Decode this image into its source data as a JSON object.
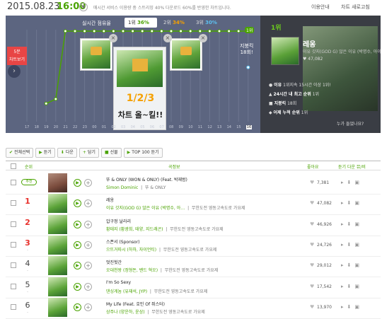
{
  "header": {
    "date": "2015.08.23",
    "time": "16:00",
    "notice": "매시간 서비스 이용량 중 스트리밍 40% 다운로드 60%를 반영한 차트입니다.",
    "info_label": "이용안내",
    "refresh_label": "차트 새로고침"
  },
  "chart": {
    "realtime_label": "실시간 점유율",
    "ranks": [
      {
        "label": "1위",
        "pct": "36%"
      },
      {
        "label": "2위",
        "pct": "34%"
      },
      {
        "label": "3위",
        "pct": "30%"
      }
    ],
    "five_min_label": "5분",
    "five_min_sub": "차트보기",
    "popup_numbers": "1/2/3",
    "popup_caption": "차트 올~킬!!",
    "stop_line1": "지붕킥",
    "stop_line2": "18회!",
    "first_badge": "1위",
    "x_ticks": [
      "17",
      "18",
      "19",
      "20",
      "21",
      "22",
      "23",
      "00",
      "01",
      "02",
      "03",
      "04",
      "05",
      "06",
      "07",
      "08",
      "09",
      "10",
      "11",
      "12",
      "13",
      "14",
      "15",
      "16"
    ],
    "current_tick": "16",
    "colors": {
      "accent": "#4aa300",
      "second": "#f5a000",
      "third": "#5cc0f0",
      "bg": "#5c6580"
    }
  },
  "chart_data": {
    "type": "line",
    "x": [
      "17",
      "18",
      "19",
      "20",
      "21",
      "22",
      "23",
      "00",
      "01",
      "02",
      "03",
      "04",
      "05",
      "06",
      "07",
      "08",
      "09",
      "10",
      "11",
      "12",
      "13",
      "14",
      "15",
      "16"
    ],
    "series": [
      {
        "values": [
          null,
          null,
          20,
          25,
          100,
          100,
          100,
          100,
          100,
          100,
          100,
          100,
          100,
          100,
          100,
          100,
          100,
          100,
          100,
          100,
          100,
          100,
          100,
          100
        ]
      },
      {
        "values": [
          null,
          null,
          null,
          null,
          null,
          null,
          null,
          null,
          null,
          null,
          null,
          null,
          null,
          null,
          null,
          null,
          null,
          null,
          null,
          null,
          null,
          null,
          null,
          100
        ]
      },
      {
        "values": [
          null,
          null,
          null,
          null,
          null,
          null,
          null,
          null,
          null,
          null,
          null,
          null,
          null,
          null,
          null,
          null,
          null,
          null,
          null,
          null,
          null,
          null,
          null,
          60
        ]
      }
    ]
  },
  "now_first": {
    "rank": "1위",
    "title": "레옹",
    "artist": "이유 갓지(GOD G) 않은 이유 (박명수, 아이유)",
    "likes": "47,082",
    "stats": [
      {
        "label": "이유",
        "text": "1위지속 15시간 이상 1위!"
      },
      {
        "label": "24시간 내 최고 순위",
        "text": "1위"
      },
      {
        "label": "지붕킥",
        "text": "18회"
      },
      {
        "label": "어제 누적 순위",
        "text": "1위"
      }
    ],
    "who_listens": "누가 들었나요?"
  },
  "toolbar": {
    "buttons": [
      "전체선택",
      "듣기",
      "다운",
      "담기",
      "선물",
      "TOP 100 듣기"
    ]
  },
  "table": {
    "headers": {
      "rank": "순위",
      "song": "곡정보",
      "likes": "좋아요",
      "actions": "듣기 다운 뮤/비"
    },
    "rows": [
      {
        "rank": "추천",
        "delta": "",
        "title": "뚜 & ONLY (WON & ONLY) (Feat. 박재범)",
        "artist": "Simon Dominic",
        "album": "뚜 & ONLY",
        "likes": "7,381",
        "rec": true
      },
      {
        "rank": "1",
        "delta": "-",
        "title": "레옹",
        "artist": "이유 갓지(GOD G) 않은 이유 (박명수, 아…",
        "album": "무한도전 영동고속도로 가요제",
        "likes": "47,082"
      },
      {
        "rank": "2",
        "delta": "-",
        "title": "압구정 날라리",
        "artist": "황태지 (황광희, 태양, 지드래곤)",
        "album": "무한도전 영동고속도로 가요제",
        "likes": "46,926"
      },
      {
        "rank": "3",
        "delta": "-",
        "title": "스폰서 (Sponsor)",
        "artist": "으뜨거따시 (하하, 자이언티)",
        "album": "무한도전 영동고속도로 가요제",
        "likes": "24,726"
      },
      {
        "rank": "4",
        "delta": "-",
        "title": "멋진헛간",
        "artist": "오대천왕 (정형돈, 밴드 혁오)",
        "album": "무한도전 영동고속도로 가요제",
        "likes": "29,012"
      },
      {
        "rank": "5",
        "delta": "-",
        "title": "I'm So Sexy",
        "artist": "댄싱게놈 (유재석, JYP)",
        "album": "무한도전 영동고속도로 가요제",
        "likes": "17,542"
      },
      {
        "rank": "6",
        "delta": "-",
        "title": "My Life (Feat. 호민 Of 쥐스터)",
        "artist": "상주나 (양운하, 윤상)",
        "album": "무한도전 영동고속도로 가요제",
        "likes": "13,970"
      }
    ]
  }
}
